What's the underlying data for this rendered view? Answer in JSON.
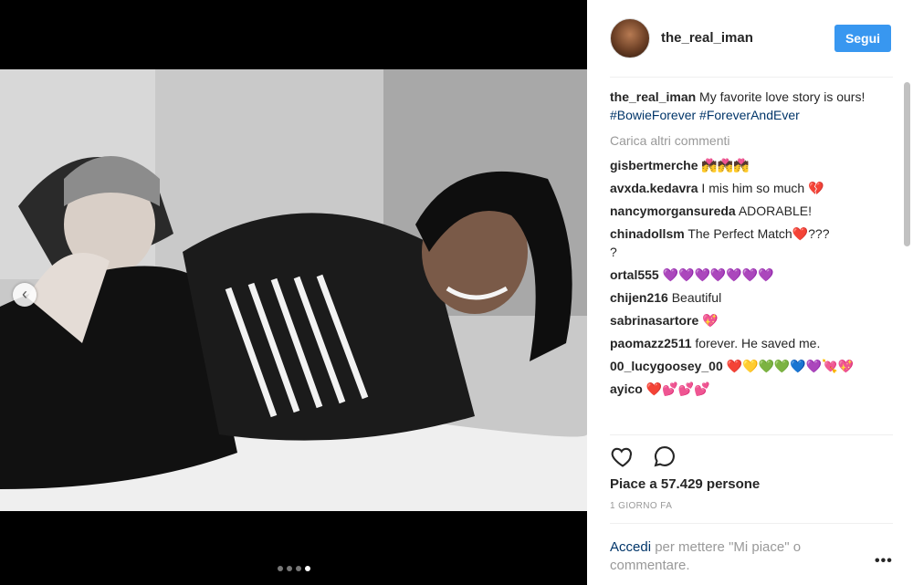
{
  "post": {
    "username": "the_real_iman",
    "follow_label": "Segui",
    "caption_text": " My favorite love story is ours! ",
    "caption_tags": [
      "#BowieForever",
      "#ForeverAndEver"
    ],
    "load_more": "Carica altri commenti",
    "likes": "Piace a 57.429 persone",
    "time": "1 GIORNO FA",
    "login_link": "Accedi",
    "login_text": " per mettere \"Mi piace\" o commentare.",
    "more_label": "•••",
    "media": {
      "slide_count": 4,
      "active_slide": 4,
      "prev_label": "‹"
    }
  },
  "comments": [
    {
      "user": "gisbertmerche",
      "text": " 💏💏💏"
    },
    {
      "user": "avxda.kedavra",
      "text": " I mis him so much 💔"
    },
    {
      "user": "nancymorgansureda",
      "text": " ADORABLE!"
    },
    {
      "user": "chinadollsm",
      "text": " The Perfect Match❤️???\n?"
    },
    {
      "user": "ortal555",
      "text": " 💜💜💜💜💜💜💜"
    },
    {
      "user": "chijen216",
      "text": " Beautiful"
    },
    {
      "user": "sabrinasartore",
      "text": " 💖"
    },
    {
      "user": "paomazz2511",
      "text": " forever. He saved me."
    },
    {
      "user": "00_lucygoosey_00",
      "text": " ❤️💛💚💚💙💜💘💖"
    },
    {
      "user": "ayico",
      "text": " ❤️💕💕💕"
    }
  ],
  "icons": {
    "heart": "heart-icon",
    "comment": "comment-icon",
    "prev": "chevron-left-icon"
  },
  "colors": {
    "accent": "#3897f0",
    "link": "#003569",
    "muted": "#999999",
    "text": "#262626"
  }
}
